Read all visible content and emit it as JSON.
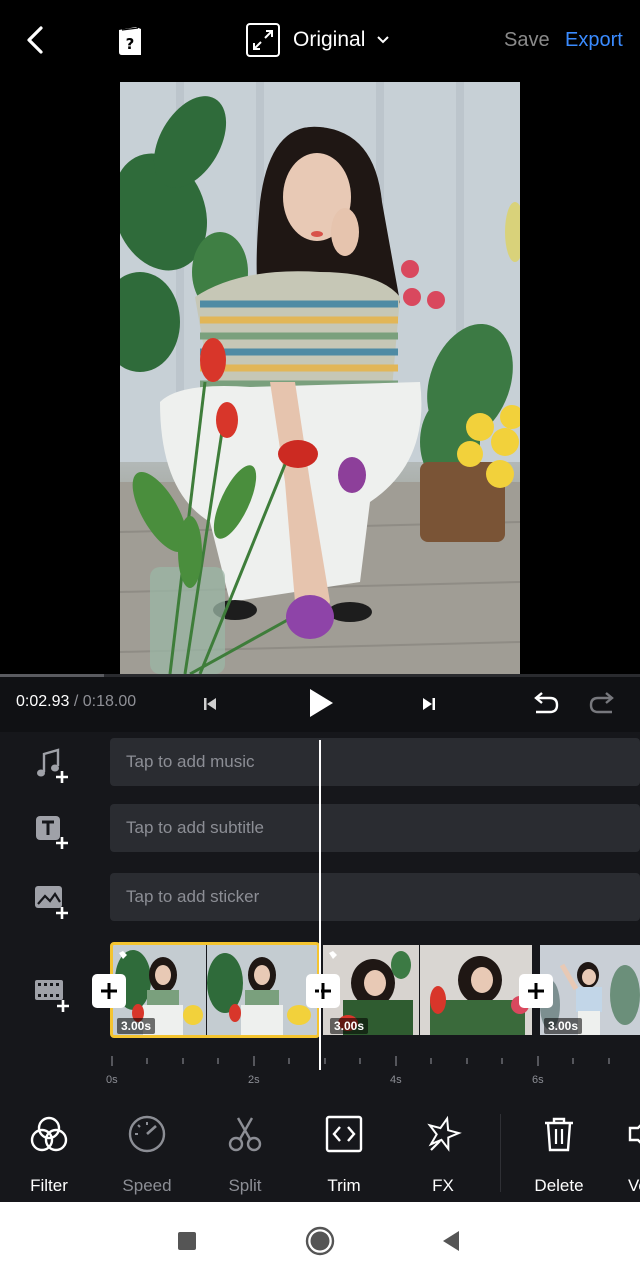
{
  "header": {
    "aspect_label": "Original",
    "save_label": "Save",
    "export_label": "Export"
  },
  "playback": {
    "current_time": "0:02.93",
    "separator": "/",
    "duration": "0:18.00",
    "progress": 0.163
  },
  "tracks": {
    "music_placeholder": "Tap to add music",
    "subtitle_placeholder": "Tap to add subtitle",
    "sticker_placeholder": "Tap to add sticker"
  },
  "clips": [
    {
      "duration": "3.00s",
      "selected": true
    },
    {
      "duration": "3.00s",
      "selected": false
    },
    {
      "duration": "3.00s",
      "selected": false
    }
  ],
  "ruler": [
    "0s",
    "2s",
    "4s",
    "6s"
  ],
  "toolbar": [
    {
      "label": "Filter",
      "icon": "filter-icon",
      "enabled": true
    },
    {
      "label": "Speed",
      "icon": "speedometer-icon",
      "enabled": false
    },
    {
      "label": "Split",
      "icon": "scissors-icon",
      "enabled": false
    },
    {
      "label": "Trim",
      "icon": "code-brackets-icon",
      "enabled": true
    },
    {
      "label": "FX",
      "icon": "sparkle-star-icon",
      "enabled": true
    },
    {
      "label": "Delete",
      "icon": "trash-icon",
      "enabled": true
    },
    {
      "label": "Vo",
      "icon": "volume-icon",
      "enabled": true
    }
  ],
  "colors": {
    "accent": "#3a8bff",
    "selection": "#f4c430",
    "panel": "#16171b",
    "track": "#2a2c31"
  }
}
